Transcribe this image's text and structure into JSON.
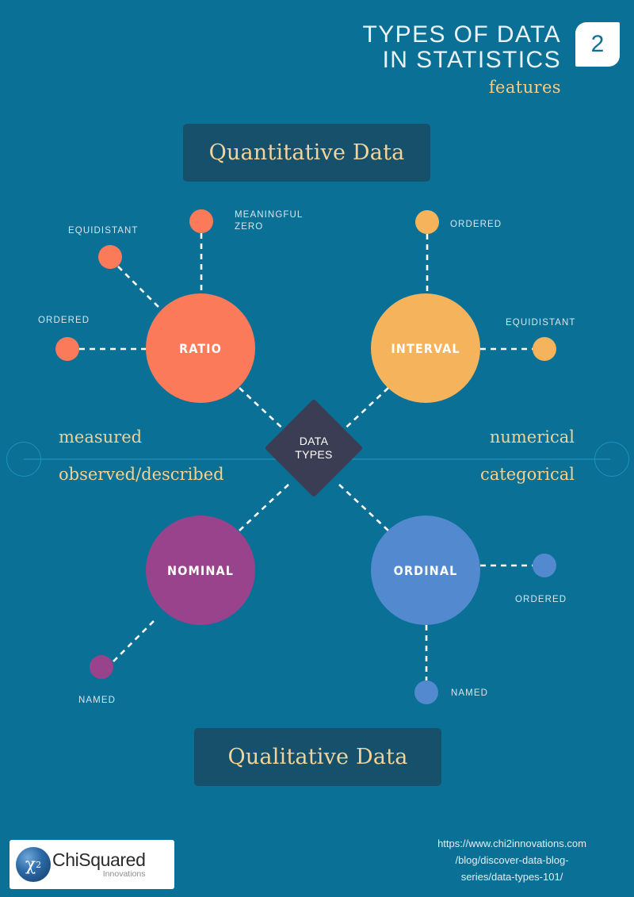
{
  "header": {
    "title_line1": "TYPES OF DATA",
    "title_line2": "IN STATISTICS",
    "subtitle": "features",
    "badge_number": "2"
  },
  "banners": {
    "top": "Quantitative Data",
    "bottom": "Qualitative Data"
  },
  "center": {
    "label_line1": "DATA",
    "label_line2": "TYPES"
  },
  "axis": {
    "left_top": "measured",
    "left_bottom": "observed/described",
    "right_top": "numerical",
    "right_bottom": "categorical"
  },
  "nodes": {
    "ratio": "RATIO",
    "interval": "INTERVAL",
    "nominal": "NOMINAL",
    "ordinal": "ORDINAL"
  },
  "features": {
    "ratio_equidistant": "EQUIDISTANT",
    "ratio_meaningful_zero": "MEANINGFUL ZERO",
    "ratio_ordered": "ORDERED",
    "interval_ordered": "ORDERED",
    "interval_equidistant": "EQUIDISTANT",
    "nominal_named": "NAMED",
    "ordinal_ordered": "ORDERED",
    "ordinal_named": "NAMED"
  },
  "footer": {
    "logo_symbol": "χ",
    "logo_exponent": "2",
    "logo_name": "ChiSquared",
    "logo_tagline": "Innovations",
    "url_line1": "https://www.chi2innovations.com",
    "url_line2": "/blog/discover-data-blog-",
    "url_line3": "series/data-types-101/"
  },
  "colors": {
    "background": "#0a7096",
    "banner": "#17506b",
    "gold": "#f2d294",
    "diamond": "#3b3d54",
    "ratio": "#fb7a5a",
    "interval": "#f5b35c",
    "nominal": "#99438c",
    "ordinal": "#5289cf",
    "axis_line": "#1785ac",
    "satellite_label": "#d9e6ee"
  }
}
